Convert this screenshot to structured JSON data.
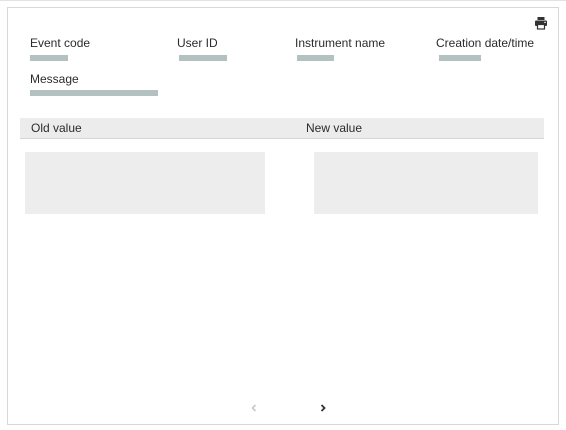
{
  "print": {
    "icon": "printer-icon"
  },
  "fields": {
    "event_code": {
      "label": "Event code"
    },
    "user_id": {
      "label": "User ID"
    },
    "instrument_name": {
      "label": "Instrument name"
    },
    "creation_datetime": {
      "label": "Creation date/time"
    },
    "message": {
      "label": "Message"
    }
  },
  "values_table": {
    "old_header": "Old value",
    "new_header": "New value"
  },
  "pager": {
    "prev_icon": "chevron-left-icon",
    "next_icon": "chevron-right-icon",
    "prev_enabled": false,
    "next_enabled": true
  },
  "colors": {
    "placeholder_bar": "#b3c1c1",
    "header_bg": "#ececec",
    "value_box_bg": "#ededed",
    "icon": "#333333",
    "icon_disabled": "#c8c8c8"
  }
}
